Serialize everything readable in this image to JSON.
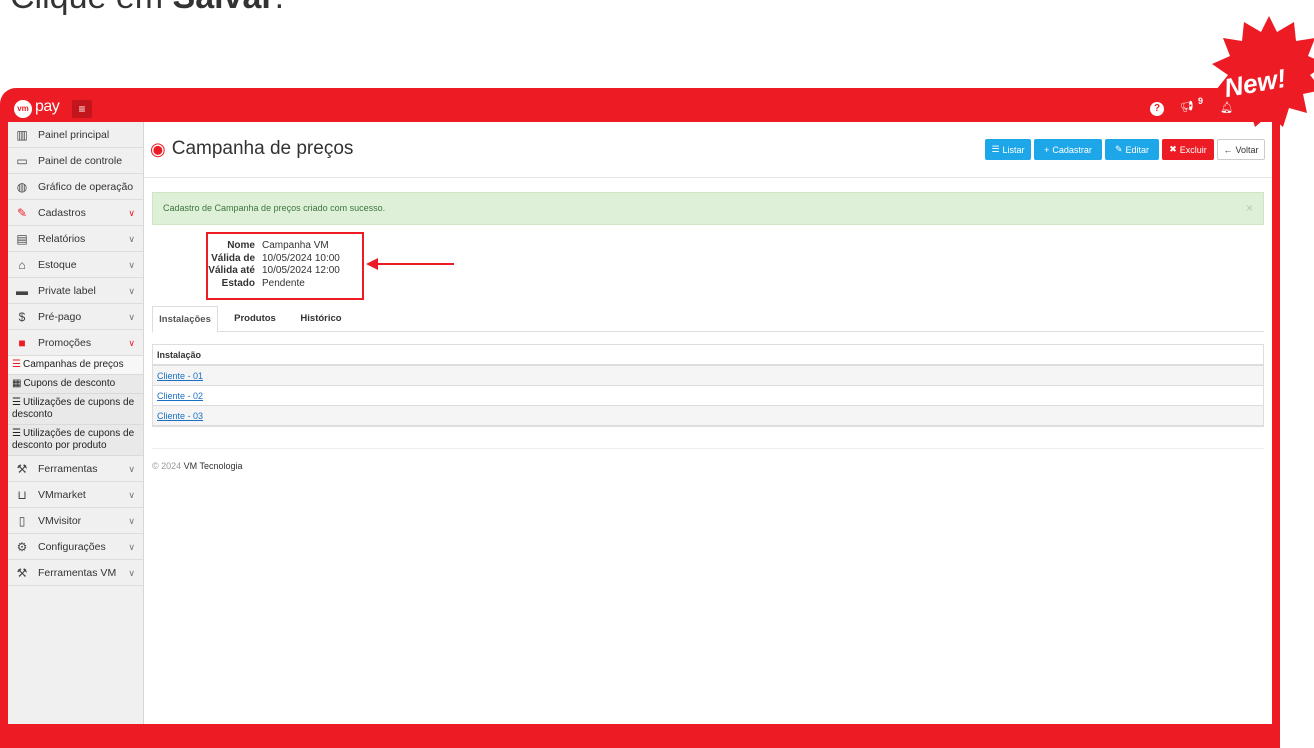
{
  "instruction": {
    "prefix": "Clique em ",
    "action": "Salvar",
    "suffix": "."
  },
  "badge": {
    "text": "New!",
    "color": "#ed1c24"
  },
  "colors": {
    "brand": "#ed1c24",
    "accent_blue": "#1ea7e8",
    "success_bg": "#dff0d8"
  },
  "topbar": {
    "logo_mark": "vm",
    "logo_text": "pay",
    "menu_icon": "hamburger-icon",
    "help_icon": "help-icon",
    "notifications_icon": "megaphone-icon",
    "notifications_count": "9",
    "bell_icon": "bell-icon"
  },
  "sidebar": {
    "items": [
      {
        "label": "Painel principal",
        "icon": "bar-chart-icon",
        "has_chevron": false
      },
      {
        "label": "Painel de controle",
        "icon": "monitor-icon",
        "has_chevron": false
      },
      {
        "label": "Gráfico de operação",
        "icon": "dashboard-icon",
        "has_chevron": false
      },
      {
        "label": "Cadastros",
        "icon": "edit-icon",
        "has_chevron": true
      },
      {
        "label": "Relatórios",
        "icon": "file-icon",
        "has_chevron": true
      },
      {
        "label": "Estoque",
        "icon": "home-icon",
        "has_chevron": true
      },
      {
        "label": "Private label",
        "icon": "credit-card-icon",
        "has_chevron": true
      },
      {
        "label": "Pré-pago",
        "icon": "dollar-icon",
        "has_chevron": true
      },
      {
        "label": "Promoções",
        "icon": "gift-icon",
        "has_chevron": true
      }
    ],
    "sub_items": [
      {
        "label": "Campanhas de preços",
        "icon": "list-icon",
        "active": true
      },
      {
        "label": "Cupons de desconto",
        "icon": "table-icon",
        "active": false
      },
      {
        "label": "Utilizações de cupons de desconto",
        "icon": "list-icon",
        "active": false
      },
      {
        "label": "Utilizações de cupons de desconto por produto",
        "icon": "list-icon",
        "active": false
      }
    ],
    "items_after": [
      {
        "label": "Ferramentas",
        "icon": "wrench-icon"
      },
      {
        "label": "VMmarket",
        "icon": "cart-icon"
      },
      {
        "label": "VMvisitor",
        "icon": "tablet-icon"
      },
      {
        "label": "Configurações",
        "icon": "cogs-icon"
      },
      {
        "label": "Ferramentas VM",
        "icon": "wrench-icon"
      }
    ]
  },
  "page": {
    "title": "Campanha de preços",
    "title_icon": "eye-icon",
    "buttons": {
      "listar": "Listar",
      "cadastrar": "Cadastrar",
      "editar": "Editar",
      "excluir": "Excluir",
      "voltar": "Voltar"
    },
    "alert": {
      "text": "Cadastro de Campanha de preços criado com sucesso.",
      "close": "×"
    },
    "details": [
      {
        "label": "Nome",
        "value": "Campanha VM"
      },
      {
        "label": "Válida de",
        "value": "10/05/2024 10:00"
      },
      {
        "label": "Válida até",
        "value": "10/05/2024 12:00"
      },
      {
        "label": "Estado",
        "value": "Pendente"
      }
    ],
    "tabs": [
      "Instalações",
      "Produtos",
      "Histórico"
    ],
    "active_tab": "Instalações",
    "table": {
      "header": "Instalação",
      "rows": [
        "Cliente - 01",
        "Cliente - 02",
        "Cliente - 03"
      ]
    },
    "footer": {
      "copyright": "© 2024 ",
      "company": "VM Tecnologia"
    }
  }
}
